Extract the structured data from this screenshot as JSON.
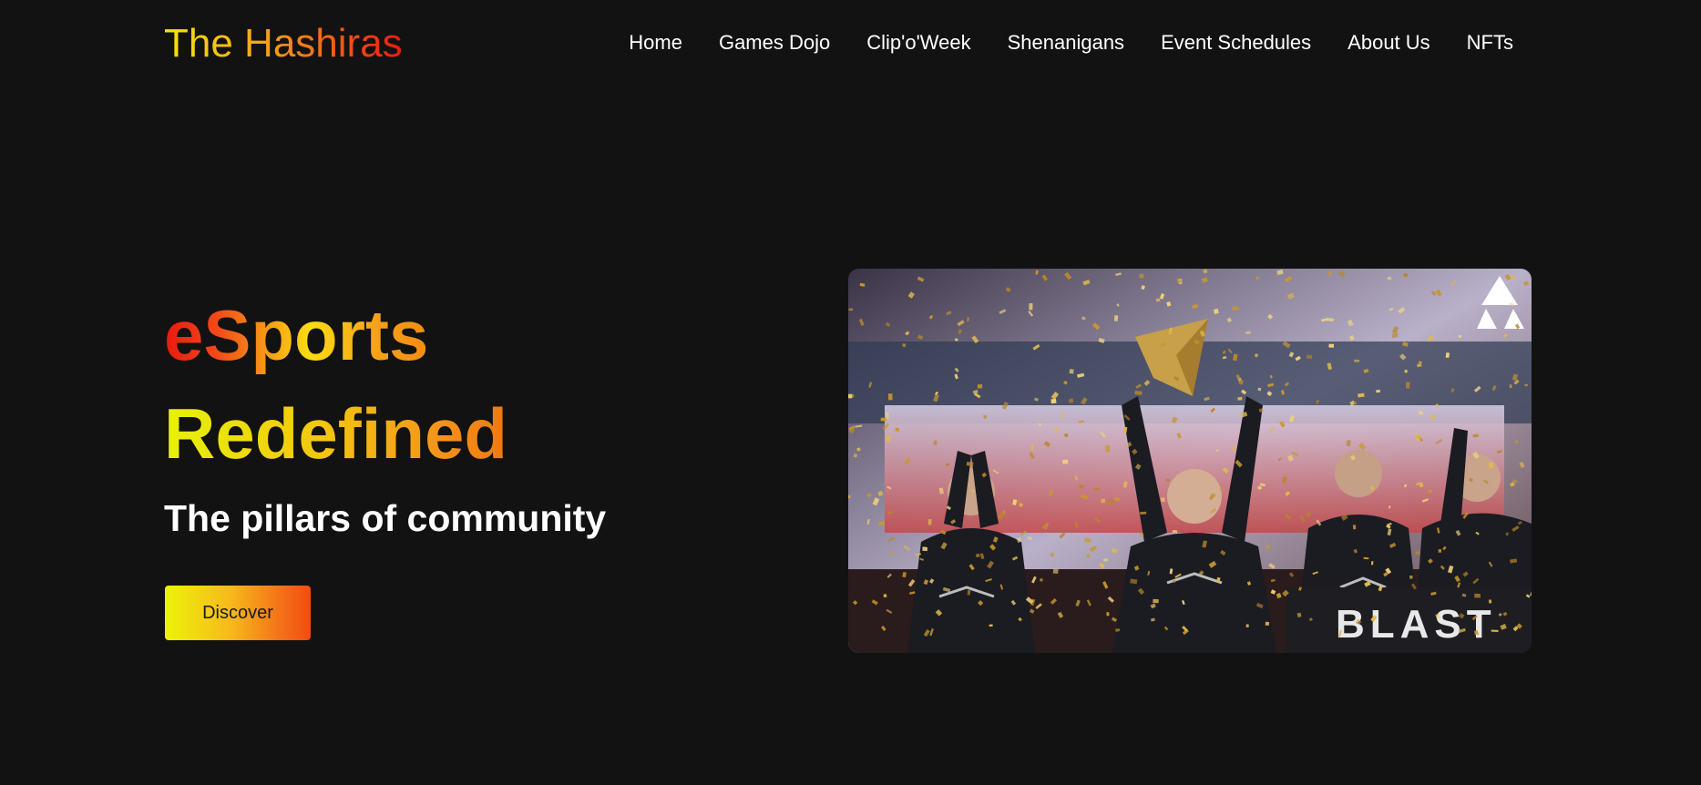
{
  "brand": {
    "logo_text": "The Hashiras"
  },
  "nav": {
    "items": [
      {
        "label": "Home"
      },
      {
        "label": "Games Dojo"
      },
      {
        "label": "Clip'o'Week"
      },
      {
        "label": "Shenanigans"
      },
      {
        "label": "Event Schedules"
      },
      {
        "label": "About Us"
      },
      {
        "label": "NFTs"
      }
    ]
  },
  "hero": {
    "title_line1": "eSports",
    "title_line2": "Redefined",
    "subtitle": "The pillars of community",
    "cta_label": "Discover",
    "image": {
      "banner_text": "BLAST",
      "alt_icon": "blast-logo-icon"
    }
  },
  "colors": {
    "background": "#121212",
    "text": "#ffffff",
    "gradient_yellow": "#edf30a",
    "gradient_orange": "#f6a21a",
    "gradient_red": "#e8190e"
  }
}
